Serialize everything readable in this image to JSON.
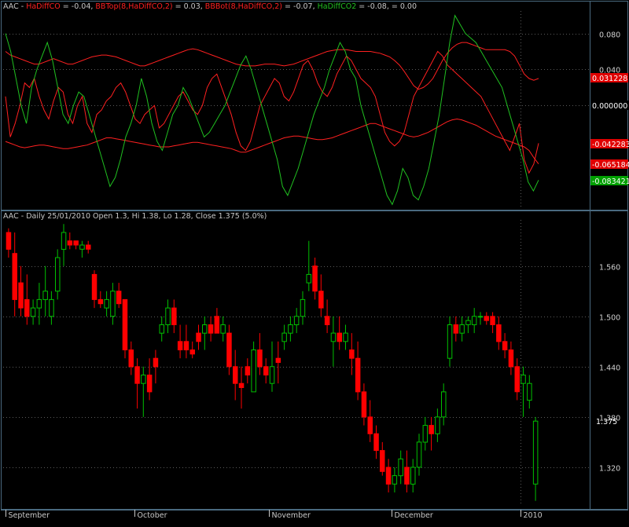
{
  "chart_data": [
    {
      "type": "line",
      "panel": "indicator",
      "header": {
        "symbol": "AAC - ",
        "items": [
          {
            "name": "HaDiffCO",
            "value": "= -0.04,",
            "color": "#ff2020"
          },
          {
            "name": "BBTop(8,HaDiffCO,2)",
            "value": "= 0.03,",
            "color": "#ff2020"
          },
          {
            "name": "BBBot(8,HaDiffCO,2)",
            "value": "= -0.07,",
            "color": "#ff2020"
          },
          {
            "name": "HaDiffCO2",
            "value": "= -0.08,",
            "color": "#20c020"
          },
          {
            "name": "",
            "value": "= 0.00",
            "color": "#c8c8c8"
          }
        ]
      },
      "ylim": [
        -0.115,
        0.105
      ],
      "yticks": [
        "0.080",
        "0.040",
        "0.000"
      ],
      "ytick_values": [
        0.08,
        0.04,
        0.0
      ],
      "value_tags": [
        {
          "label": "0.031228",
          "value": 0.0312,
          "bg": "#e00000",
          "fg": "#ffffff"
        },
        {
          "label": "0.000000",
          "value": 0.0,
          "bg": "#000000",
          "fg": "#ffffff"
        },
        {
          "label": "-0.042283",
          "value": -0.0423,
          "bg": "#e00000",
          "fg": "#ffffff"
        },
        {
          "label": "-0.065184",
          "value": -0.0652,
          "bg": "#e00000",
          "fg": "#ffffff"
        },
        {
          "label": "-0.083421",
          "value": -0.0834,
          "bg": "#00a000",
          "fg": "#ffffff"
        }
      ],
      "series": [
        {
          "name": "BBTop(8,HaDiffCO,2)",
          "color": "#ff2020",
          "values": [
            0.06,
            0.056,
            0.054,
            0.052,
            0.05,
            0.048,
            0.046,
            0.046,
            0.048,
            0.05,
            0.052,
            0.05,
            0.048,
            0.046,
            0.046,
            0.048,
            0.05,
            0.052,
            0.054,
            0.055,
            0.056,
            0.056,
            0.055,
            0.054,
            0.052,
            0.05,
            0.048,
            0.046,
            0.044,
            0.044,
            0.046,
            0.048,
            0.05,
            0.052,
            0.054,
            0.056,
            0.058,
            0.06,
            0.062,
            0.063,
            0.062,
            0.06,
            0.058,
            0.056,
            0.054,
            0.052,
            0.05,
            0.048,
            0.046,
            0.045,
            0.044,
            0.044,
            0.044,
            0.045,
            0.046,
            0.046,
            0.046,
            0.045,
            0.044,
            0.045,
            0.046,
            0.048,
            0.05,
            0.052,
            0.054,
            0.056,
            0.058,
            0.06,
            0.061,
            0.062,
            0.062,
            0.062,
            0.061,
            0.06,
            0.06,
            0.06,
            0.06,
            0.059,
            0.058,
            0.056,
            0.054,
            0.05,
            0.045,
            0.038,
            0.03,
            0.022,
            0.018,
            0.02,
            0.024,
            0.03,
            0.04,
            0.05,
            0.058,
            0.064,
            0.068,
            0.07,
            0.07,
            0.068,
            0.066,
            0.064,
            0.062,
            0.062,
            0.062,
            0.062,
            0.062,
            0.06,
            0.055,
            0.045,
            0.035,
            0.03,
            0.028,
            0.03
          ]
        },
        {
          "name": "BBBot(8,HaDiffCO,2)",
          "color": "#ff2020",
          "values": [
            -0.04,
            -0.042,
            -0.044,
            -0.046,
            -0.047,
            -0.046,
            -0.045,
            -0.044,
            -0.044,
            -0.045,
            -0.046,
            -0.047,
            -0.048,
            -0.048,
            -0.047,
            -0.046,
            -0.045,
            -0.044,
            -0.042,
            -0.04,
            -0.038,
            -0.036,
            -0.036,
            -0.037,
            -0.038,
            -0.039,
            -0.04,
            -0.041,
            -0.042,
            -0.043,
            -0.044,
            -0.045,
            -0.046,
            -0.046,
            -0.046,
            -0.045,
            -0.044,
            -0.043,
            -0.042,
            -0.041,
            -0.041,
            -0.042,
            -0.043,
            -0.044,
            -0.045,
            -0.046,
            -0.047,
            -0.048,
            -0.05,
            -0.052,
            -0.052,
            -0.05,
            -0.048,
            -0.046,
            -0.044,
            -0.042,
            -0.04,
            -0.038,
            -0.036,
            -0.035,
            -0.034,
            -0.034,
            -0.035,
            -0.036,
            -0.037,
            -0.038,
            -0.038,
            -0.037,
            -0.036,
            -0.034,
            -0.032,
            -0.03,
            -0.028,
            -0.026,
            -0.024,
            -0.022,
            -0.02,
            -0.02,
            -0.022,
            -0.024,
            -0.026,
            -0.028,
            -0.03,
            -0.032,
            -0.034,
            -0.035,
            -0.034,
            -0.032,
            -0.03,
            -0.027,
            -0.024,
            -0.021,
            -0.018,
            -0.016,
            -0.015,
            -0.016,
            -0.018,
            -0.02,
            -0.022,
            -0.025,
            -0.028,
            -0.031,
            -0.034,
            -0.036,
            -0.038,
            -0.04,
            -0.042,
            -0.044,
            -0.046,
            -0.05,
            -0.058,
            -0.065
          ]
        },
        {
          "name": "HaDiffCO",
          "color": "#ff2020",
          "values": [
            0.01,
            -0.035,
            -0.02,
            0.0,
            0.025,
            0.02,
            0.03,
            0.01,
            -0.005,
            -0.015,
            0.005,
            0.02,
            0.015,
            -0.01,
            -0.02,
            0.0,
            0.01,
            -0.02,
            -0.03,
            -0.01,
            -0.005,
            0.005,
            0.01,
            0.02,
            0.025,
            0.015,
            0.0,
            -0.015,
            -0.02,
            -0.01,
            -0.005,
            0.0,
            -0.025,
            -0.02,
            -0.01,
            0.0,
            0.01,
            0.015,
            0.005,
            -0.005,
            -0.01,
            0.0,
            0.02,
            0.03,
            0.035,
            0.02,
            0.005,
            -0.01,
            -0.03,
            -0.045,
            -0.05,
            -0.04,
            -0.02,
            0.0,
            0.01,
            0.02,
            0.03,
            0.025,
            0.01,
            0.005,
            0.015,
            0.03,
            0.045,
            0.05,
            0.04,
            0.025,
            0.015,
            0.01,
            0.02,
            0.035,
            0.045,
            0.055,
            0.05,
            0.04,
            0.03,
            0.025,
            0.02,
            0.01,
            -0.01,
            -0.03,
            -0.04,
            -0.045,
            -0.04,
            -0.03,
            -0.01,
            0.01,
            0.02,
            0.03,
            0.04,
            0.05,
            0.06,
            0.055,
            0.045,
            0.04,
            0.035,
            0.03,
            0.025,
            0.02,
            0.015,
            0.01,
            0.0,
            -0.01,
            -0.02,
            -0.03,
            -0.04,
            -0.05,
            -0.035,
            -0.02,
            -0.06,
            -0.075,
            -0.065,
            -0.042
          ]
        },
        {
          "name": "HaDiffCO2",
          "color": "#20c020",
          "values": [
            0.08,
            0.06,
            0.03,
            0.0,
            -0.02,
            0.02,
            0.04,
            0.055,
            0.07,
            0.05,
            0.02,
            -0.01,
            -0.02,
            0.0,
            0.015,
            0.01,
            -0.01,
            -0.03,
            -0.05,
            -0.07,
            -0.09,
            -0.08,
            -0.06,
            -0.035,
            -0.02,
            0.0,
            0.03,
            0.01,
            -0.02,
            -0.04,
            -0.05,
            -0.03,
            -0.01,
            0.0,
            0.02,
            0.01,
            -0.005,
            -0.02,
            -0.035,
            -0.03,
            -0.02,
            -0.01,
            0.0,
            0.015,
            0.03,
            0.045,
            0.055,
            0.04,
            0.02,
            0.0,
            -0.02,
            -0.04,
            -0.06,
            -0.09,
            -0.1,
            -0.085,
            -0.07,
            -0.05,
            -0.03,
            -0.01,
            0.005,
            0.02,
            0.04,
            0.055,
            0.07,
            0.06,
            0.04,
            0.03,
            0.0,
            -0.02,
            -0.04,
            -0.06,
            -0.08,
            -0.1,
            -0.11,
            -0.095,
            -0.07,
            -0.08,
            -0.1,
            -0.105,
            -0.09,
            -0.07,
            -0.04,
            -0.01,
            0.03,
            0.07,
            0.1,
            0.09,
            0.08,
            0.075,
            0.07,
            0.06,
            0.05,
            0.04,
            0.03,
            0.02,
            0.0,
            -0.02,
            -0.04,
            -0.06,
            -0.085,
            -0.095,
            -0.083
          ]
        }
      ]
    },
    {
      "type": "candlestick",
      "panel": "price",
      "title": "AAC - Daily 25/01/2010 Open 1.3, Hi 1.38, Lo 1.28, Close 1.375 (5.0%)",
      "ylim": [
        1.275,
        1.615
      ],
      "yticks": [
        "1.560",
        "1.500",
        "1.440",
        "1.380",
        "1.320"
      ],
      "ytick_values": [
        1.56,
        1.5,
        1.44,
        1.38,
        1.32
      ],
      "last_price_label": "1.375",
      "last_price": 1.375,
      "x_labels": [
        {
          "label": "September",
          "bar": 0
        },
        {
          "label": "October",
          "bar": 21
        },
        {
          "label": "November",
          "bar": 43
        },
        {
          "label": "December",
          "bar": 63
        },
        {
          "label": "2010",
          "bar": 84
        }
      ],
      "up_color": "#00c000",
      "down_color": "#ff0000",
      "ohlc": [
        [
          1.6,
          1.605,
          1.57,
          1.58
        ],
        [
          1.575,
          1.6,
          1.5,
          1.52
        ],
        [
          1.54,
          1.56,
          1.5,
          1.51
        ],
        [
          1.52,
          1.55,
          1.49,
          1.5
        ],
        [
          1.5,
          1.52,
          1.49,
          1.51
        ],
        [
          1.51,
          1.54,
          1.49,
          1.52
        ],
        [
          1.52,
          1.56,
          1.5,
          1.53
        ],
        [
          1.5,
          1.53,
          1.49,
          1.52
        ],
        [
          1.53,
          1.58,
          1.52,
          1.57
        ],
        [
          1.58,
          1.61,
          1.56,
          1.6
        ],
        [
          1.59,
          1.6,
          1.58,
          1.585
        ],
        [
          1.59,
          1.59,
          1.58,
          1.585
        ],
        [
          1.58,
          1.59,
          1.57,
          1.585
        ],
        [
          1.585,
          1.59,
          1.575,
          1.58
        ],
        [
          1.55,
          1.555,
          1.51,
          1.52
        ],
        [
          1.52,
          1.53,
          1.51,
          1.515
        ],
        [
          1.51,
          1.53,
          1.5,
          1.52
        ],
        [
          1.5,
          1.54,
          1.49,
          1.53
        ],
        [
          1.53,
          1.54,
          1.51,
          1.515
        ],
        [
          1.52,
          1.52,
          1.45,
          1.46
        ],
        [
          1.46,
          1.47,
          1.43,
          1.44
        ],
        [
          1.44,
          1.45,
          1.39,
          1.42
        ],
        [
          1.42,
          1.44,
          1.38,
          1.43
        ],
        [
          1.43,
          1.45,
          1.4,
          1.41
        ],
        [
          1.45,
          1.46,
          1.42,
          1.44
        ],
        [
          1.48,
          1.5,
          1.47,
          1.49
        ],
        [
          1.49,
          1.52,
          1.48,
          1.51
        ],
        [
          1.51,
          1.52,
          1.48,
          1.49
        ],
        [
          1.47,
          1.49,
          1.45,
          1.46
        ],
        [
          1.47,
          1.49,
          1.45,
          1.46
        ],
        [
          1.46,
          1.47,
          1.45,
          1.455
        ],
        [
          1.48,
          1.49,
          1.46,
          1.47
        ],
        [
          1.48,
          1.5,
          1.46,
          1.49
        ],
        [
          1.49,
          1.5,
          1.47,
          1.48
        ],
        [
          1.5,
          1.51,
          1.48,
          1.48
        ],
        [
          1.48,
          1.5,
          1.47,
          1.49
        ],
        [
          1.48,
          1.49,
          1.43,
          1.44
        ],
        [
          1.44,
          1.46,
          1.4,
          1.42
        ],
        [
          1.42,
          1.44,
          1.39,
          1.415
        ],
        [
          1.44,
          1.45,
          1.42,
          1.43
        ],
        [
          1.41,
          1.47,
          1.41,
          1.46
        ],
        [
          1.46,
          1.48,
          1.43,
          1.44
        ],
        [
          1.44,
          1.45,
          1.42,
          1.43
        ],
        [
          1.42,
          1.47,
          1.41,
          1.44
        ],
        [
          1.45,
          1.47,
          1.42,
          1.445
        ],
        [
          1.47,
          1.49,
          1.46,
          1.48
        ],
        [
          1.48,
          1.5,
          1.47,
          1.49
        ],
        [
          1.49,
          1.51,
          1.48,
          1.5
        ],
        [
          1.5,
          1.53,
          1.49,
          1.52
        ],
        [
          1.54,
          1.59,
          1.53,
          1.55
        ],
        [
          1.56,
          1.57,
          1.52,
          1.53
        ],
        [
          1.53,
          1.55,
          1.5,
          1.51
        ],
        [
          1.5,
          1.52,
          1.48,
          1.49
        ],
        [
          1.47,
          1.5,
          1.44,
          1.48
        ],
        [
          1.48,
          1.5,
          1.46,
          1.47
        ],
        [
          1.47,
          1.49,
          1.46,
          1.48
        ],
        [
          1.46,
          1.48,
          1.43,
          1.45
        ],
        [
          1.45,
          1.47,
          1.4,
          1.41
        ],
        [
          1.41,
          1.42,
          1.37,
          1.38
        ],
        [
          1.38,
          1.4,
          1.35,
          1.36
        ],
        [
          1.36,
          1.37,
          1.33,
          1.34
        ],
        [
          1.34,
          1.35,
          1.31,
          1.315
        ],
        [
          1.32,
          1.33,
          1.29,
          1.3
        ],
        [
          1.3,
          1.32,
          1.29,
          1.31
        ],
        [
          1.31,
          1.34,
          1.3,
          1.33
        ],
        [
          1.32,
          1.34,
          1.29,
          1.3
        ],
        [
          1.3,
          1.33,
          1.29,
          1.32
        ],
        [
          1.32,
          1.36,
          1.31,
          1.35
        ],
        [
          1.35,
          1.38,
          1.34,
          1.37
        ],
        [
          1.37,
          1.38,
          1.34,
          1.36
        ],
        [
          1.36,
          1.39,
          1.35,
          1.38
        ],
        [
          1.38,
          1.42,
          1.37,
          1.41
        ],
        [
          1.45,
          1.5,
          1.44,
          1.49
        ],
        [
          1.49,
          1.5,
          1.47,
          1.48
        ],
        [
          1.48,
          1.5,
          1.47,
          1.49
        ],
        [
          1.49,
          1.5,
          1.48,
          1.495
        ],
        [
          1.49,
          1.51,
          1.48,
          1.5
        ],
        [
          1.5,
          1.505,
          1.49,
          1.5
        ],
        [
          1.5,
          1.505,
          1.49,
          1.495
        ],
        [
          1.5,
          1.505,
          1.48,
          1.49
        ],
        [
          1.49,
          1.5,
          1.46,
          1.47
        ],
        [
          1.47,
          1.48,
          1.45,
          1.46
        ],
        [
          1.46,
          1.47,
          1.43,
          1.44
        ],
        [
          1.44,
          1.45,
          1.4,
          1.41
        ],
        [
          1.42,
          1.44,
          1.38,
          1.43
        ],
        [
          1.4,
          1.43,
          1.39,
          1.42
        ],
        [
          1.3,
          1.38,
          1.28,
          1.375
        ]
      ]
    }
  ]
}
